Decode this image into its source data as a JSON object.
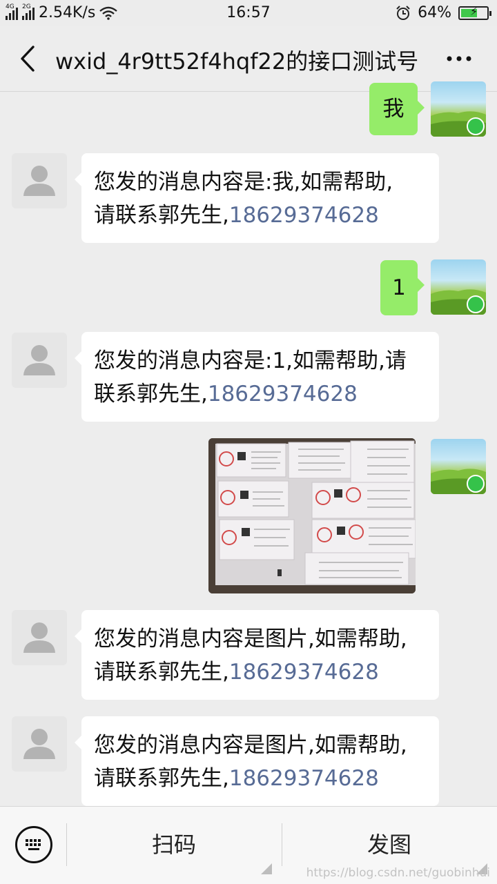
{
  "status_bar": {
    "net_4g": "4G",
    "net_2g": "2G",
    "speed": "2.54K/s",
    "time": "16:57",
    "battery": "64%",
    "battery_level": 0.64,
    "icons": [
      "signal-icon",
      "wifi-icon",
      "alarm-icon",
      "battery-icon"
    ]
  },
  "header": {
    "title": "wxid_4r9tt52f4hqf22的接口测试号",
    "back_icon": "chevron-left-icon",
    "more_icon": "more-dots-icon"
  },
  "messages": [
    {
      "side": "right",
      "type": "text",
      "text": "我"
    },
    {
      "side": "left",
      "type": "text",
      "line1": "您发的消息内容是:我,如需帮助,",
      "line2_prefix": "请联系郭先生,",
      "phone": "18629374628"
    },
    {
      "side": "right",
      "type": "text",
      "text": "1"
    },
    {
      "side": "left",
      "type": "text",
      "line1": "您发的消息内容是:1,如需帮助,请",
      "line2_prefix": "联系郭先生,",
      "phone": "18629374628"
    },
    {
      "side": "right",
      "type": "image",
      "description": "receipts-photo"
    },
    {
      "side": "left",
      "type": "text",
      "line1": "您发的消息内容是图片,如需帮助,",
      "line2_prefix": "请联系郭先生,",
      "phone": "18629374628"
    },
    {
      "side": "left",
      "type": "text",
      "line1": "您发的消息内容是图片,如需帮助,",
      "line2_prefix": "请联系郭先生,",
      "phone": "18629374628"
    }
  ],
  "bottom_bar": {
    "keyboard_icon": "keyboard-icon",
    "scan_label": "扫码",
    "send_image_label": "发图"
  },
  "watermark": "https://blog.csdn.net/guobinhui",
  "colors": {
    "background": "#ededed",
    "my_bubble": "#95ec69",
    "their_bubble": "#ffffff",
    "link": "#576b95",
    "verified": "#35c24a"
  }
}
